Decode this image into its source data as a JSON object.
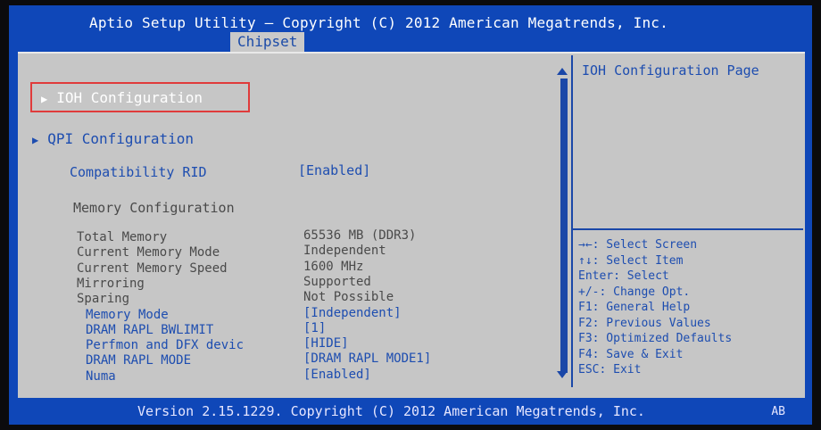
{
  "header": {
    "title": "Aptio Setup Utility – Copyright (C) 2012 American Megatrends, Inc.",
    "tab": "Chipset"
  },
  "menu": {
    "selected": "IOH Configuration",
    "qpi": "QPI Configuration",
    "compat_label": "Compatibility RID",
    "compat_value": "[Enabled]",
    "memory_heading": "Memory Configuration"
  },
  "memory_items": [
    {
      "label": "Total Memory",
      "value": "65536 MB (DDR3)"
    },
    {
      "label": "Current Memory Mode",
      "value": "Independent"
    },
    {
      "label": "Current Memory Speed",
      "value": "1600 MHz"
    },
    {
      "label": "Mirroring",
      "value": "Supported"
    },
    {
      "label": "Sparing",
      "value": "Not Possible"
    },
    {
      "label": "Memory Mode",
      "value": "[Independent]"
    },
    {
      "label": "DRAM RAPL BWLIMIT",
      "value": "[1]"
    },
    {
      "label": "Perfmon and DFX devic",
      "value": "[HIDE]"
    },
    {
      "label": "DRAM RAPL MODE",
      "value": "[DRAM RAPL MODE1]"
    },
    {
      "label": "Numa",
      "value": "[Enabled]"
    }
  ],
  "help": {
    "text": "IOH Configuration Page"
  },
  "keys": [
    "→←: Select Screen",
    "↑↓: Select Item",
    "Enter: Select",
    "+/-: Change Opt.",
    "F1: General Help",
    "F2: Previous Values",
    "F3: Optimized Defaults",
    "F4: Save & Exit",
    "ESC: Exit"
  ],
  "footer": {
    "version": "Version 2.15.1229. Copyright (C) 2012 American Megatrends, Inc.",
    "code": "AB"
  }
}
